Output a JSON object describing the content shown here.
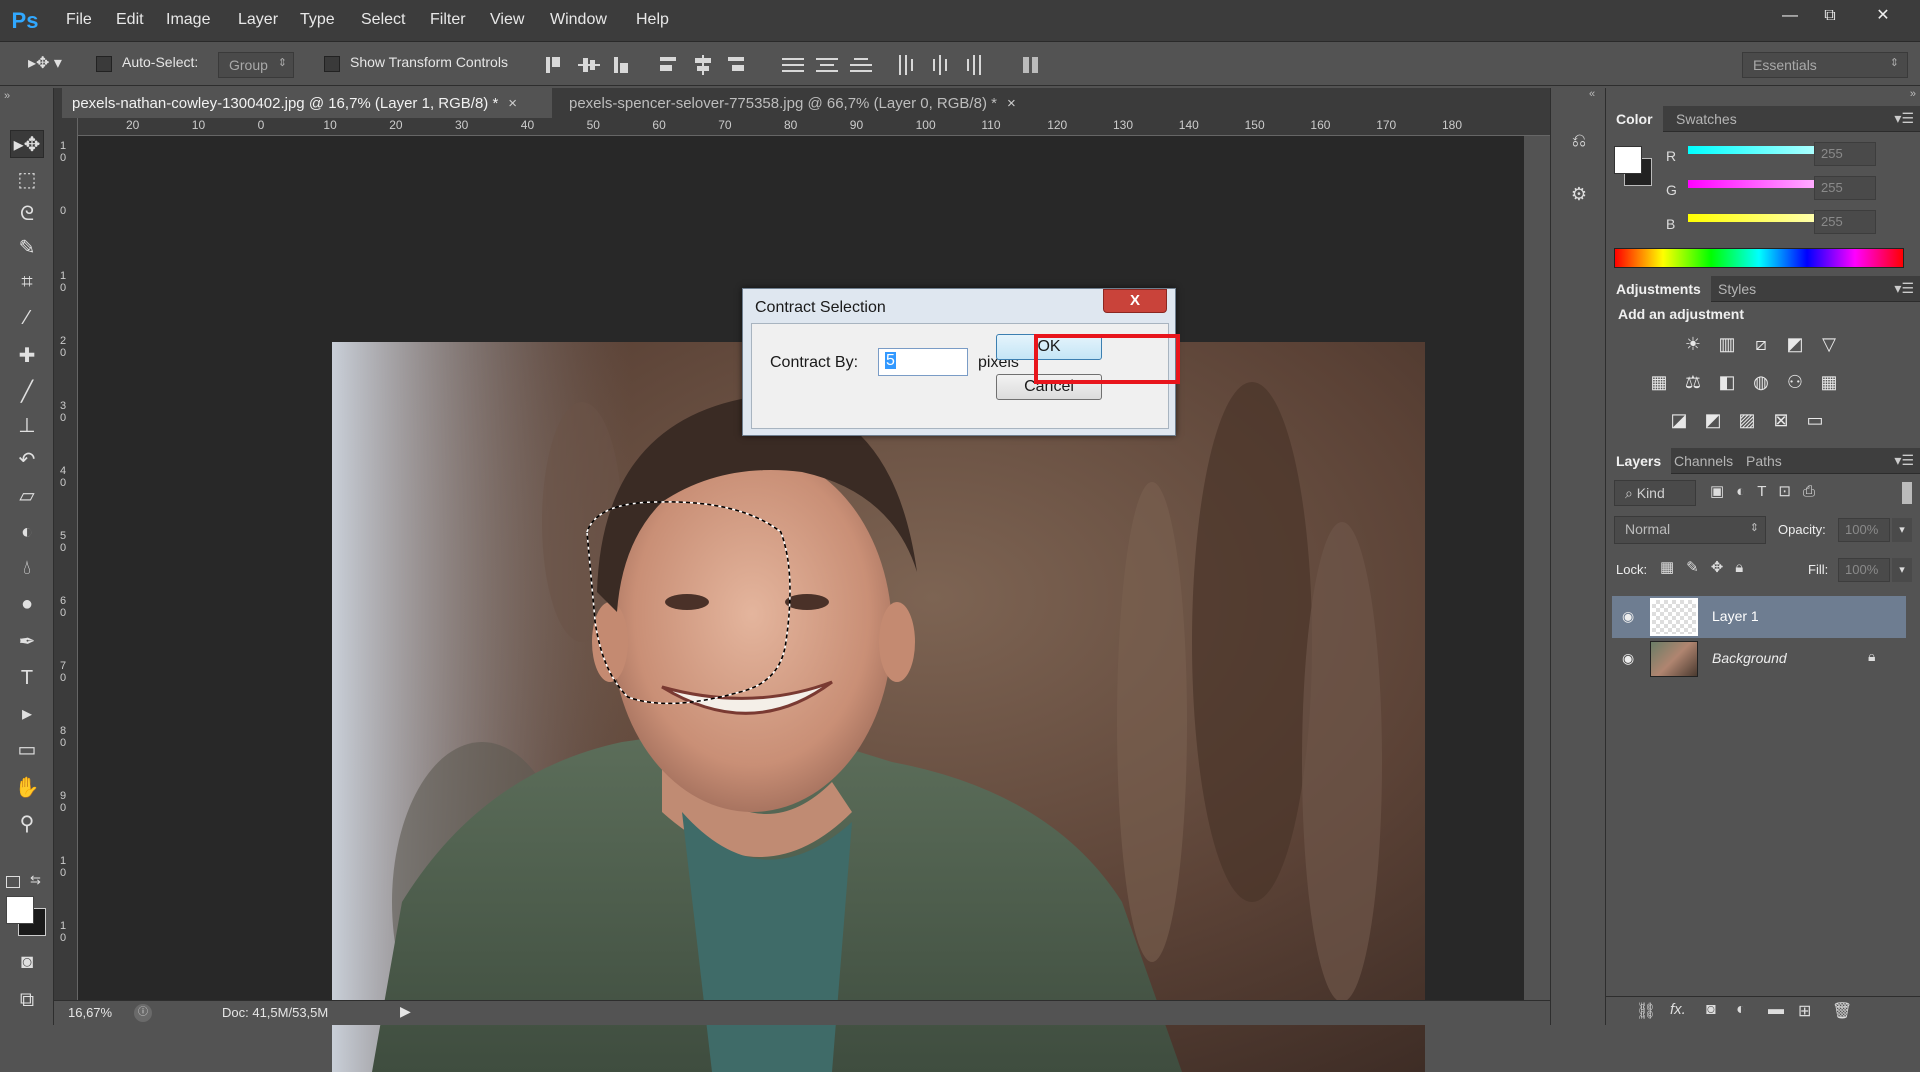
{
  "app": {
    "logo": "Ps",
    "workspace": "Essentials"
  },
  "menu": [
    "File",
    "Edit",
    "Image",
    "Layer",
    "Type",
    "Select",
    "Filter",
    "View",
    "Window",
    "Help"
  ],
  "window_controls": {
    "minimize": "—",
    "restore": "⧉",
    "close": "✕"
  },
  "options_bar": {
    "auto_select_label": "Auto-Select:",
    "auto_select_value": "Group",
    "show_transform_label": "Show Transform Controls"
  },
  "tabs": [
    {
      "label": "pexels-nathan-cowley-1300402.jpg @ 16,7% (Layer 1, RGB/8) *",
      "close": "×"
    },
    {
      "label": "pexels-spencer-selover-775358.jpg @ 66,7% (Layer 0, RGB/8) *",
      "close": "×"
    }
  ],
  "ruler_top": [
    "20",
    "10",
    "0",
    "10",
    "20",
    "30",
    "40",
    "50",
    "60",
    "70",
    "80",
    "90",
    "100",
    "110",
    "120",
    "130",
    "140",
    "150",
    "160",
    "170",
    "180"
  ],
  "ruler_left": [
    "1\n0",
    "0",
    "1\n0",
    "2\n0",
    "3\n0",
    "4\n0",
    "5\n0",
    "6\n0",
    "7\n0",
    "8\n0",
    "9\n0",
    "1\n0",
    "1\n0"
  ],
  "status": {
    "zoom": "16,67%",
    "doc": "Doc: 41,5M/53,5M"
  },
  "panels": {
    "color": {
      "tab_active": "Color",
      "tab_other": "Swatches",
      "channels": [
        {
          "label": "R",
          "value": "255",
          "color": "#00ffff"
        },
        {
          "label": "G",
          "value": "255",
          "color": "#ff00ff"
        },
        {
          "label": "B",
          "value": "255",
          "color": "#ffff00"
        }
      ]
    },
    "adjustments": {
      "tab_active": "Adjustments",
      "tab_other": "Styles",
      "heading": "Add an adjustment"
    },
    "layers": {
      "tabs": [
        "Layers",
        "Channels",
        "Paths"
      ],
      "kind_label": "Kind",
      "blend_mode": "Normal",
      "opacity_label": "Opacity:",
      "opacity_value": "100%",
      "lock_label": "Lock:",
      "fill_label": "Fill:",
      "fill_value": "100%",
      "items": [
        {
          "name": "Layer 1",
          "selected": true
        },
        {
          "name": "Background",
          "selected": false
        }
      ]
    }
  },
  "dialog": {
    "title": "Contract Selection",
    "close": "X",
    "label": "Contract By:",
    "value": "5",
    "unit": "pixels",
    "ok": "OK",
    "cancel": "Cancel"
  }
}
